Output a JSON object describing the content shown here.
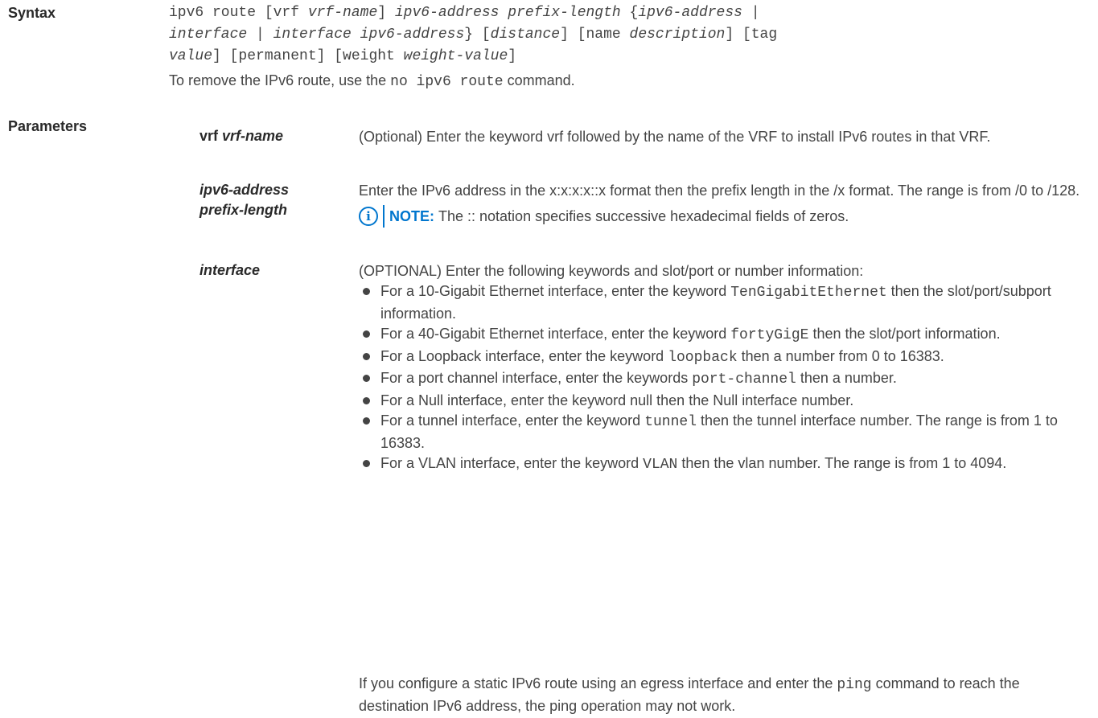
{
  "labels": {
    "syntax": "Syntax",
    "parameters": "Parameters"
  },
  "syntax": {
    "line1": [
      {
        "t": "ipv6 route [vrf ",
        "i": false
      },
      {
        "t": "vrf-name",
        "i": true
      },
      {
        "t": "] ",
        "i": false
      },
      {
        "t": "ipv6-address prefix-length",
        "i": true
      },
      {
        "t": " {",
        "i": false
      },
      {
        "t": "ipv6-address",
        "i": true
      },
      {
        "t": " |",
        "i": false
      }
    ],
    "line2": [
      {
        "t": "interface",
        "i": true
      },
      {
        "t": " | ",
        "i": false
      },
      {
        "t": "interface ipv6-address",
        "i": true
      },
      {
        "t": "} [",
        "i": false
      },
      {
        "t": "distance",
        "i": true
      },
      {
        "t": "] [name ",
        "i": false
      },
      {
        "t": "description",
        "i": true
      },
      {
        "t": "] [tag",
        "i": false
      }
    ],
    "line3": [
      {
        "t": "value",
        "i": true
      },
      {
        "t": "] [permanent] [weight ",
        "i": false
      },
      {
        "t": "weight-value",
        "i": true
      },
      {
        "t": "]",
        "i": false
      }
    ]
  },
  "remove": {
    "before": "To remove the IPv6 route, use the ",
    "code": "no ipv6 route",
    "after": " command."
  },
  "params": {
    "vrf": {
      "term_keyword": "vrf ",
      "term_arg": "vrf-name",
      "desc": "(Optional) Enter the keyword vrf followed by the name of the VRF to install IPv6 routes in that VRF."
    },
    "ipv6": {
      "term_line1": "ipv6-address",
      "term_line2": "prefix-length",
      "desc": "Enter the IPv6 address in the x:x:x:x::x format then the prefix length in the /x format. The range is from /0 to /128.",
      "note_label": "NOTE:",
      "note_text": "The :: notation specifies successive hexadecimal fields of zeros."
    },
    "interface": {
      "term": "interface",
      "intro": "(OPTIONAL) Enter the following keywords and slot/port or number information:",
      "bullets": [
        {
          "a": "For a 10-Gigabit Ethernet interface, enter the keyword ",
          "code": "TenGigabitEthernet",
          "b": " then the slot/port/subport information."
        },
        {
          "a": "For a 40-Gigabit Ethernet interface, enter the keyword ",
          "code": "fortyGigE",
          "b": " then the slot/port information."
        },
        {
          "a": "For a Loopback interface, enter the keyword ",
          "code": "loopback",
          "b": " then a number from 0 to 16383."
        },
        {
          "a": "For a port channel interface, enter the keywords ",
          "code": "port-channel",
          "b": " then a number."
        },
        {
          "a": "For a Null interface, enter the keyword null then the Null interface number.",
          "code": "",
          "b": ""
        },
        {
          "a": "For a tunnel interface, enter the keyword ",
          "code": "tunnel",
          "b": " then the tunnel interface number. The range is from 1 to 16383."
        },
        {
          "a": "For a VLAN interface, enter the keyword ",
          "code": "VLAN",
          "b": " then the vlan number. The range is from 1 to 4094."
        }
      ]
    }
  },
  "footer": {
    "before": "If you configure a static IPv6 route using an egress interface and enter the ",
    "code": "ping",
    "after": " command to reach the destination IPv6 address, the ping operation may not work."
  },
  "colors": {
    "note_accent": "#0076ce",
    "body_text": "#444444",
    "label_text": "#2a2a2a"
  },
  "icons": {
    "note": "info-circle-icon"
  }
}
